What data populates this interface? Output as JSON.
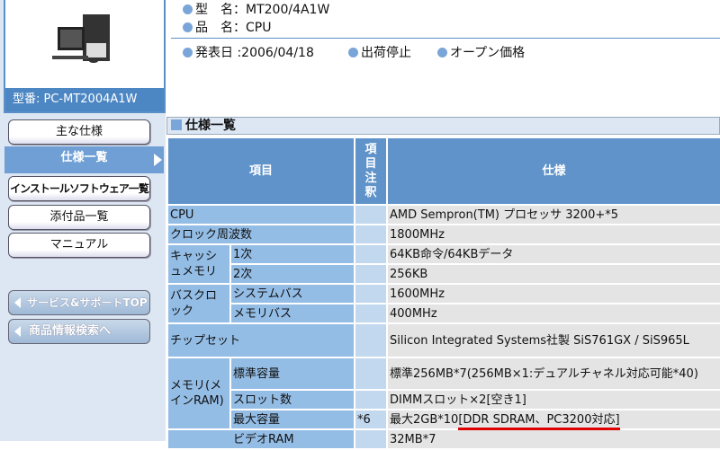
{
  "product": {
    "model_caption": "型番: PC-MT2004A1W",
    "type_name": "型　名：MT200/4A1W",
    "product_name": "品　名：CPU",
    "release_date": "発表日 :2006/04/18",
    "shipping_status": "出荷停止",
    "price": "オープン価格"
  },
  "sidebar": {
    "items": [
      {
        "label": "主な仕様"
      },
      {
        "label": "仕様一覧"
      },
      {
        "label": "インストールソフトウェア一覧"
      },
      {
        "label": "添付品一覧"
      },
      {
        "label": "マニュアル"
      }
    ],
    "links": [
      {
        "label": "サービス&サポートTOPへ"
      },
      {
        "label": "商品情報検索へ"
      }
    ]
  },
  "section_title": "仕様一覧",
  "table": {
    "headers": {
      "item": "項目",
      "note": "項目注釈",
      "spec": "仕様"
    },
    "rows": {
      "cpu": {
        "item": "CPU",
        "note": "",
        "spec": "AMD Sempron(TM) プロセッサ 3200+*5"
      },
      "clock": {
        "item": "クロック周波数",
        "note": "",
        "spec": "1800MHz"
      },
      "cache": {
        "group": "キャッシュメモリ",
        "l1": {
          "item": "1次",
          "spec": "64KB命令/64KBデータ"
        },
        "l2": {
          "item": "2次",
          "spec": "256KB"
        }
      },
      "bus": {
        "group": "バスクロック",
        "sys": {
          "item": "システムバス",
          "spec": "1600MHz"
        },
        "mem": {
          "item": "メモリバス",
          "spec": "400MHz"
        }
      },
      "chipset": {
        "item": "チップセット",
        "spec": "Silicon Integrated Systems社製 SiS761GX / SiS965L"
      },
      "memory": {
        "group": "メモリ(メインRAM)",
        "std": {
          "item": "標準容量",
          "spec": "標準256MB*7(256MB×1:デュアルチャネル対応可能*40)"
        },
        "slot": {
          "item": "スロット数",
          "spec": "DIMMスロット×2[空き1]"
        },
        "max": {
          "item": "最大容量",
          "note": "*6",
          "spec_prefix": "最大2GB*10",
          "spec_highlight": "[DDR SDRAM、PC3200対応]"
        }
      },
      "video": {
        "item": "ビデオRAM",
        "spec": "32MB*7"
      }
    }
  },
  "colors": {
    "accent": "#5f93c9",
    "annotation": "#e00000"
  }
}
